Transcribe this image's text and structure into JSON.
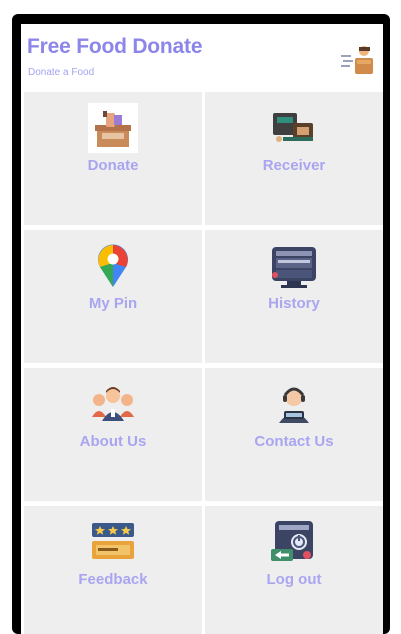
{
  "app": {
    "title": "Free Food Donate",
    "subtitle": "Donate a Food"
  },
  "menu": [
    {
      "label": "Donate",
      "icon": "donate-box-icon"
    },
    {
      "label": "Receiver",
      "icon": "food-delivery-icon"
    },
    {
      "label": "My Pin",
      "icon": "map-pin-icon"
    },
    {
      "label": "History",
      "icon": "history-screen-icon"
    },
    {
      "label": "About Us",
      "icon": "team-people-icon"
    },
    {
      "label": "Contact Us",
      "icon": "support-agent-icon"
    },
    {
      "label": "Feedback",
      "icon": "rating-stars-icon"
    },
    {
      "label": "Log out",
      "icon": "logout-screen-icon"
    }
  ],
  "colors": {
    "accent": "#8c86ea",
    "tile_background": "#eeeeee",
    "label": "#a9a5f0"
  }
}
